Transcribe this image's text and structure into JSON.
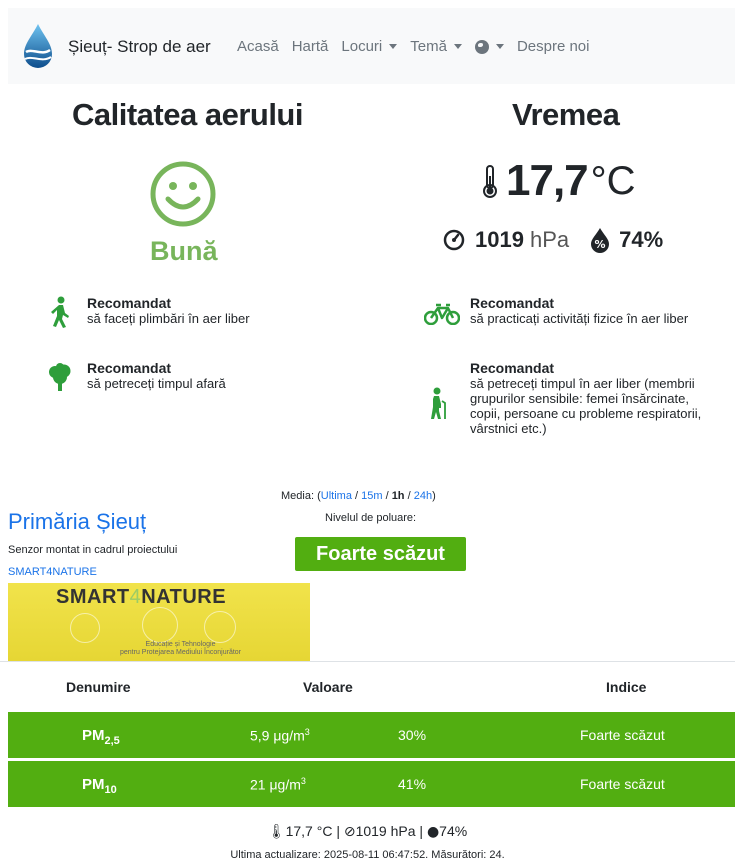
{
  "brand": {
    "name": "Șieuț- Strop de aer"
  },
  "nav": {
    "home": "Acasă",
    "map": "Hartă",
    "places": "Locuri",
    "theme": "Temă",
    "about": "Despre noi"
  },
  "air": {
    "heading": "Calitatea aerului",
    "status": "Bună",
    "status_color": "#78b55b"
  },
  "weather": {
    "heading": "Vremea",
    "temperature": "17,7",
    "temperature_unit": "°C",
    "pressure": "1019",
    "pressure_unit": "hPa",
    "humidity": "74%"
  },
  "recommendations": [
    {
      "title": "Recomandat",
      "text": "să faceți plimbări în aer liber",
      "icon": "walking-icon"
    },
    {
      "title": "Recomandat",
      "text": "să practicați activități fizice în aer liber",
      "icon": "bicycle-icon"
    },
    {
      "title": "Recomandat",
      "text": "să petreceți timpul afară",
      "icon": "tree-icon"
    },
    {
      "title": "Recomandat",
      "text": "să petreceți timpul în aer liber (membrii grupurilor sensibile: femei însărcinate, copii, persoane cu probleme respiratorii, vârstnici etc.)",
      "icon": "elderly-person-icon"
    }
  ],
  "sensor": {
    "title": "Primăria Șieuț",
    "description": "Senzor montat in cadrul proiectului",
    "project_link": "SMART4NATURE",
    "banner_title_a": "SMART",
    "banner_title_b": "4",
    "banner_title_c": "NATURE",
    "banner_sub1": "Educație și Tehnologie",
    "banner_sub2": "pentru Protejarea Mediului Înconjurător"
  },
  "media": {
    "label": "Media:",
    "options": [
      "Ultima",
      "15m",
      "1h",
      "24h"
    ],
    "selected": "1h",
    "pollution_label": "Nivelul de poluare:",
    "pollution_level": "Foarte scăzut",
    "level_color": "#52ae11"
  },
  "table": {
    "headers": [
      "Denumire",
      "Valoare",
      "Indice"
    ],
    "rows": [
      {
        "name": "PM",
        "sub": "2,5",
        "value": "5,9 μg/m",
        "percent": "30%",
        "index": "Foarte scăzut"
      },
      {
        "name": "PM",
        "sub": "10",
        "value": "21 μg/m",
        "percent": "41%",
        "index": "Foarte scăzut"
      }
    ]
  },
  "footer": {
    "summary": "17,7 °C | ",
    "pressure": "1019 hPa | ",
    "humidity": "74%",
    "updated": "Ultima actualizare: 2025-08-11 06:47:52. Măsurători: 24."
  }
}
